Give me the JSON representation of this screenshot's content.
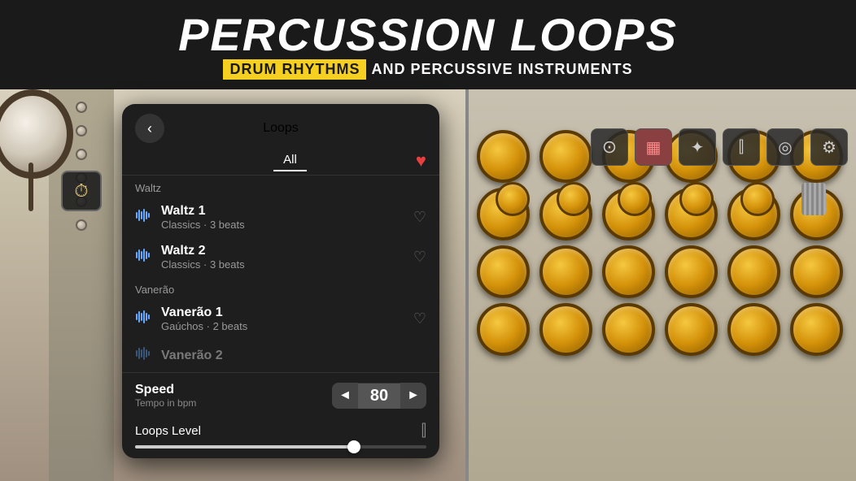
{
  "header": {
    "title": "PERCUSSION LOOPS",
    "subtitle_highlight": "DRUM RHYTHMS",
    "subtitle_rest": "AND PERCUSSIVE INSTRUMENTS"
  },
  "panel": {
    "title": "Loops",
    "tab_all": "All",
    "back_label": "‹",
    "sections": [
      {
        "name": "Waltz",
        "items": [
          {
            "title": "Waltz 1",
            "subtitle": "Classics · 3 beats",
            "liked": false
          },
          {
            "title": "Waltz 2",
            "subtitle": "Classics · 3 beats",
            "liked": false
          }
        ]
      },
      {
        "name": "Vanerão",
        "items": [
          {
            "title": "Vanerão 1",
            "subtitle": "Gaúchos · 2 beats",
            "liked": false
          },
          {
            "title": "Vanerão 2",
            "subtitle": "",
            "liked": false,
            "faded": true
          }
        ]
      }
    ],
    "speed": {
      "label": "Speed",
      "desc": "Tempo in bpm",
      "value": "80",
      "dec_btn": "◄",
      "inc_btn": "►"
    },
    "level": {
      "label": "Loops Level",
      "slider_pct": 75
    }
  },
  "toolbar": {
    "icons": [
      {
        "name": "metronome-icon",
        "glyph": "⊙",
        "active": false
      },
      {
        "name": "grid-icon",
        "glyph": "▦",
        "active": true
      },
      {
        "name": "wand-icon",
        "glyph": "✦",
        "active": false
      },
      {
        "name": "mixer-icon",
        "glyph": "⫿",
        "active": false
      },
      {
        "name": "headphone-icon",
        "glyph": "◎",
        "active": false
      },
      {
        "name": "gear-icon",
        "glyph": "⚙",
        "active": false
      }
    ]
  },
  "colors": {
    "accent_yellow": "#f5d020",
    "heart_red": "#e84040",
    "bg_dark": "#1e1e1e",
    "bg_panel": "#2a2a2a",
    "knob_gold": "#d4920a",
    "text_white": "#ffffff",
    "text_gray": "#999999"
  }
}
